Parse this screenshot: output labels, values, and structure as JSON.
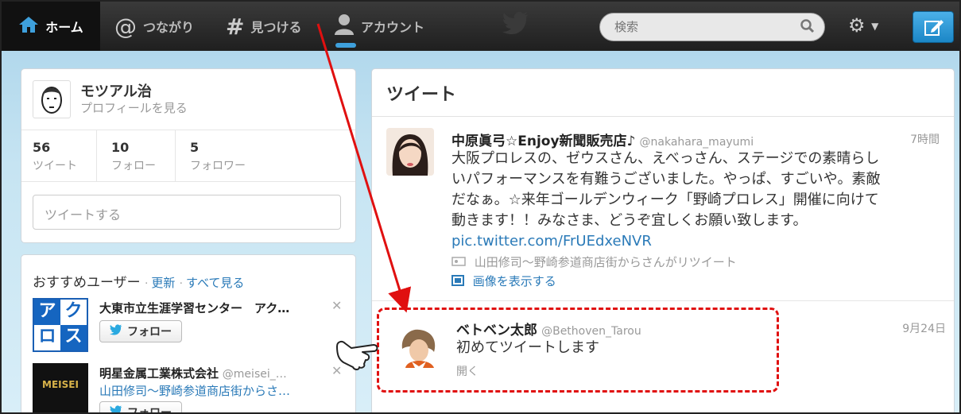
{
  "nav": {
    "home": "ホーム",
    "connect": "つながり",
    "discover": "見つける",
    "account": "アカウント",
    "search_placeholder": "検索"
  },
  "profile": {
    "name": "モツアル治",
    "view_profile": "プロフィールを見る",
    "stats": [
      {
        "count": "56",
        "label": "ツイート"
      },
      {
        "count": "10",
        "label": "フォロー"
      },
      {
        "count": "5",
        "label": "フォロワー"
      }
    ],
    "compose_placeholder": "ツイートする"
  },
  "recommend": {
    "title": "おすすめユーザー",
    "refresh": "更新",
    "view_all": "すべて見る",
    "users": [
      {
        "name": "大東市立生涯学習センター　アク…",
        "follow": "フォロー"
      },
      {
        "name": "明星金属工業株式会社",
        "handle": "@meisei_…",
        "sub": "山田修司〜野崎参道商店街からさ…",
        "follow": "フォロー",
        "logo": "MEISEI"
      }
    ],
    "avatar_logo": [
      "ア",
      "ク",
      "ロ",
      "ス"
    ]
  },
  "timeline": {
    "title": "ツイート",
    "tweets": [
      {
        "name": "中原眞弓☆Enjoy新聞販売店♪",
        "handle": "@nakahara_mayumi",
        "time": "7時間",
        "lines": [
          "大阪プロレスの、ゼウスさん、えべっさん、ステージでの素晴らし",
          "いパフォーマンスを有難うございました。やっぱ、すごいや。素敵",
          "だなぁ。☆来年ゴールデンウィーク「野崎プロレス」開催に向けて",
          "動きます！！みなさま、どうぞ宜しくお願い致します。"
        ],
        "link": "pic.twitter.com/FrUEdxeNVR",
        "retweeted_by": "山田修司〜野崎参道商店街からさんがリツイート",
        "show_media": "画像を表示する"
      },
      {
        "name": "ベトベン太郎",
        "handle": "@Bethoven_Tarou",
        "time": "9月24日",
        "text": "初めてツイートします",
        "open": "開く"
      }
    ]
  }
}
